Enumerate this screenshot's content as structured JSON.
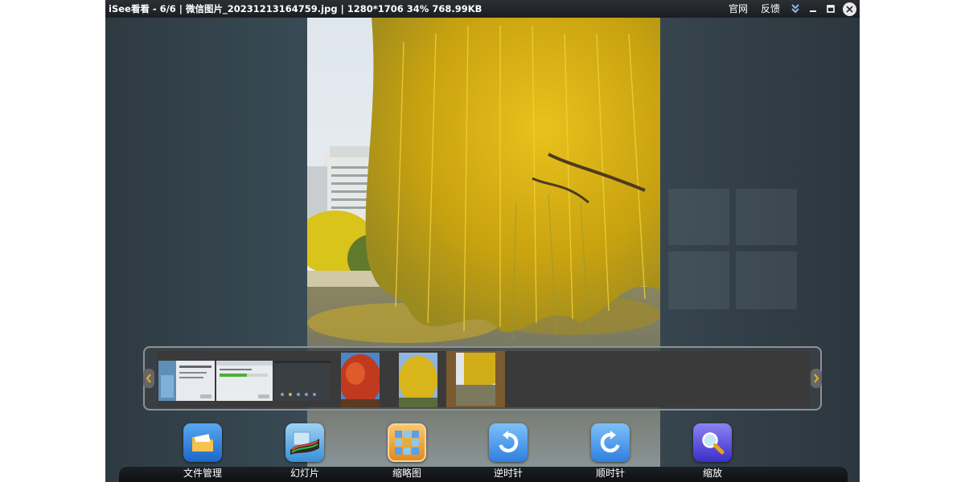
{
  "window": {
    "title": "iSee看看 - 6/6 | 微信图片_20231213164759.jpg | 1280*1706  34%  768.99KB",
    "links": [
      "官网",
      "反馈"
    ]
  },
  "filmstrip": {
    "thumbnails": [
      "thumb-screenshot-1",
      "thumb-screenshot-2",
      "thumb-screenshot-3",
      "thumb-red-tree",
      "thumb-yellow-willow",
      "thumb-willow-lake"
    ],
    "selected_index": 5
  },
  "toolbar": {
    "items": [
      {
        "label": "文件管理",
        "icon": "folder-icon"
      },
      {
        "label": "幻灯片",
        "icon": "slideshow-icon"
      },
      {
        "label": "缩略图",
        "icon": "thumbnails-icon"
      },
      {
        "label": "逆时针",
        "icon": "rotate-ccw-icon"
      },
      {
        "label": "顺时针",
        "icon": "rotate-cw-icon"
      },
      {
        "label": "缩放",
        "icon": "zoom-icon"
      }
    ]
  },
  "colors": {
    "accent_blue": "#2f7fe0",
    "frame_bg": "#33414a"
  }
}
